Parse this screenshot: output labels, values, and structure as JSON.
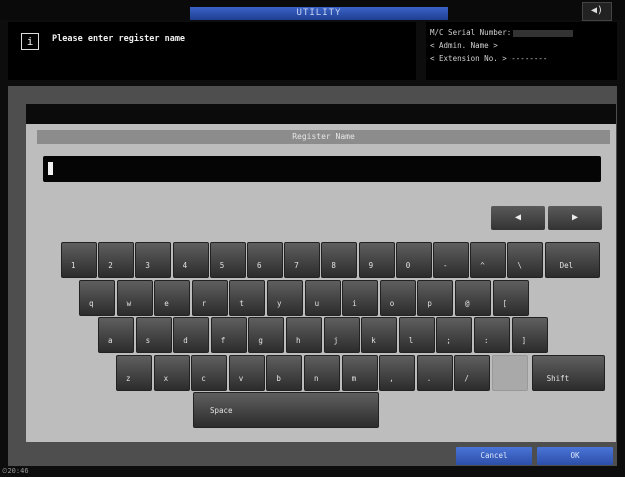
{
  "header": {
    "tab_label": "UTILITY",
    "speaker_icon": "speaker-icon",
    "message": "Please enter register name",
    "info_icon_glyph": "i",
    "serial_label": "M/C Serial Number:",
    "admin_label": "< Admin. Name >",
    "extension_label": "< Extension No. >",
    "extension_value": "--------"
  },
  "dialog": {
    "field_title": "Register Name",
    "input_value": ""
  },
  "cursor": {
    "left": "◀",
    "right": "▶"
  },
  "keyboard": {
    "row1": [
      "1",
      "2",
      "3",
      "4",
      "5",
      "6",
      "7",
      "8",
      "9",
      "0",
      "-",
      "^",
      "\\",
      "Del"
    ],
    "row2": [
      "q",
      "w",
      "e",
      "r",
      "t",
      "y",
      "u",
      "i",
      "o",
      "p",
      "@",
      "["
    ],
    "row3": [
      "a",
      "s",
      "d",
      "f",
      "g",
      "h",
      "j",
      "k",
      "l",
      ";",
      ":",
      "]"
    ],
    "row4": [
      "z",
      "x",
      "c",
      "v",
      "b",
      "n",
      "m",
      ",",
      ".",
      "/",
      "",
      "Shift"
    ],
    "space": "Space"
  },
  "footer": {
    "cancel": "Cancel",
    "ok": "OK"
  },
  "status": {
    "time": "20:46"
  },
  "colors": {
    "accent_blue": "#2c4fa8",
    "panel_gray": "#bdbdbd"
  }
}
